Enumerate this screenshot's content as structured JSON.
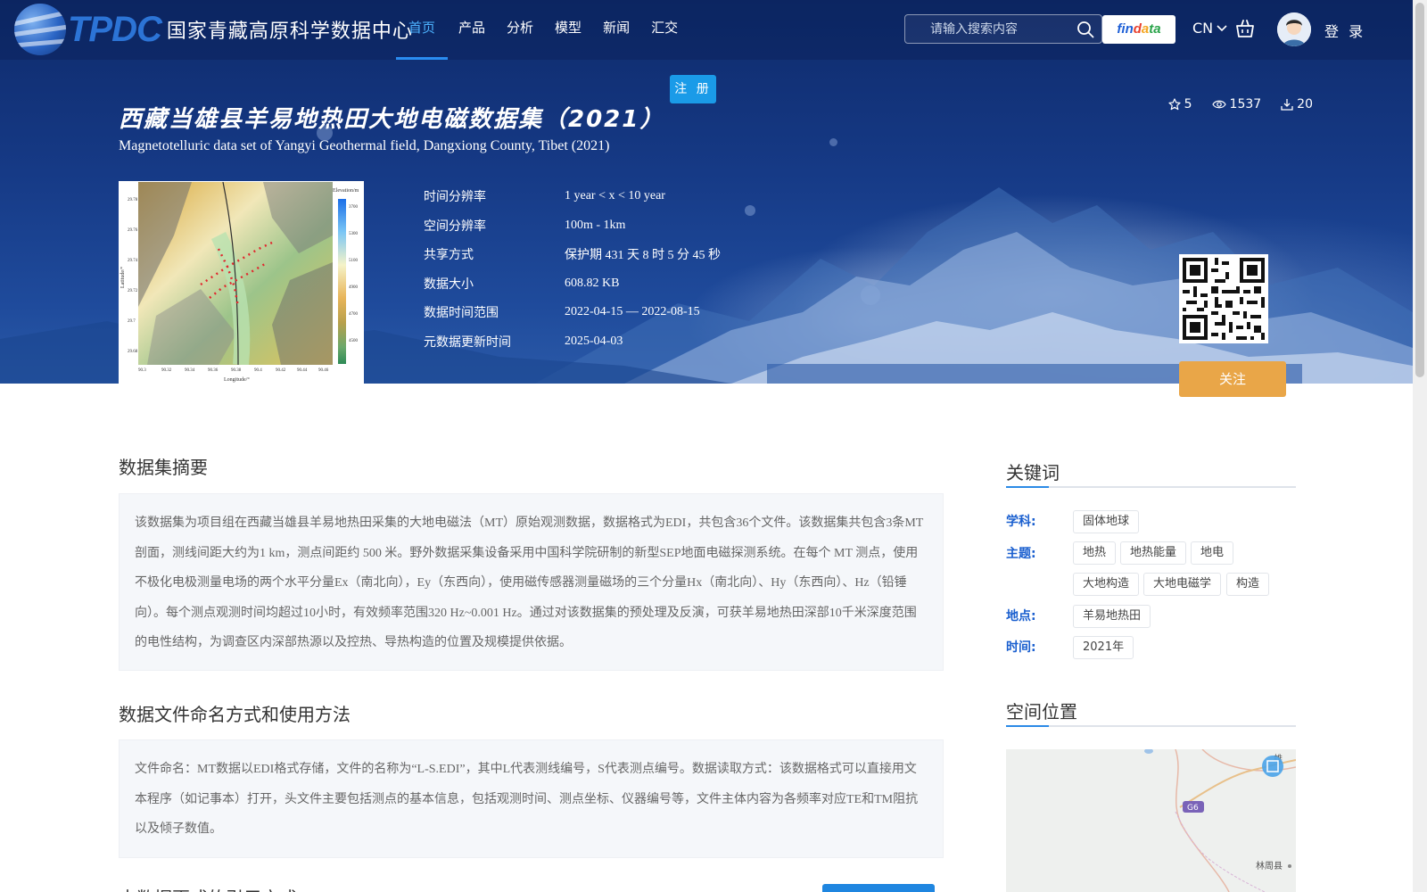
{
  "nav": {
    "logo_text": "TPDC",
    "logo_name": "国家青藏高原科学数据中心",
    "menu": [
      {
        "label": "首页",
        "active": true
      },
      {
        "label": "产品"
      },
      {
        "label": "分析"
      },
      {
        "label": "模型"
      },
      {
        "label": "新闻"
      },
      {
        "label": "汇交"
      }
    ],
    "search_placeholder": "请输入搜索内容",
    "findata": [
      "fin",
      "d",
      "a",
      "ta"
    ],
    "lang": "CN",
    "login": "登 录",
    "register": "注 册"
  },
  "dataset": {
    "title_cn": "西藏当雄县羊易地热田大地电磁数据集（2021）",
    "title_en": "Magnetotelluric data set of Yangyi Geothermal field, Dangxiong County, Tibet (2021)",
    "stats": {
      "stars": "5",
      "views": "1537",
      "downloads": "20"
    },
    "meta": [
      {
        "key": "时间分辨率",
        "value": "1 year < x < 10 year"
      },
      {
        "key": "空间分辨率",
        "value": "100m - 1km"
      },
      {
        "key": "共享方式",
        "value": "保护期 431 天 8 时 5 分 45 秒"
      },
      {
        "key": "数据大小",
        "value": "608.82 KB"
      },
      {
        "key": "数据时间范围",
        "value": "2022-04-15 — 2022-08-15"
      },
      {
        "key": "元数据更新时间",
        "value": "2025-04-03"
      }
    ],
    "thumbnail": {
      "legend_title": "Elevation/m",
      "legend_ticks": [
        "3700",
        "5300",
        "5100",
        "4900",
        "4700",
        "4500"
      ],
      "y_ticks": [
        "29.78",
        "29.76",
        "29.74",
        "29.72",
        "29.7",
        "29.68"
      ],
      "x_ticks": [
        "90.3",
        "90.32",
        "90.34",
        "90.36",
        "90.38",
        "90.4",
        "90.42",
        "90.44",
        "90.46"
      ],
      "xlabel": "Longitude/°",
      "ylabel": "Latitude/°"
    },
    "follow": "关注"
  },
  "abstract": {
    "title": "数据集摘要",
    "text": "该数据集为项目组在西藏当雄县羊易地热田采集的大地电磁法（MT）原始观测数据，数据格式为EDI，共包含36个文件。该数据集共包含3条MT剖面，测线间距大约为1 km，测点间距约 500 米。野外数据采集设备采用中国科学院研制的新型SEP地面电磁探测系统。在每个 MT 测点，使用不极化电极测量电场的两个水平分量Ex（南北向），Ey（东西向），使用磁传感器测量磁场的三个分量Hx（南北向）、Hy（东西向）、Hz（铅锤向）。每个测点观测时间均超过10小时，有效频率范围320 Hz~0.001 Hz。通过对该数据集的预处理及反演，可获羊易地热田深部10千米深度范围的电性结构，为调查区内深部热源以及控热、导热构造的位置及规模提供依据。"
  },
  "naming": {
    "title": "数据文件命名方式和使用方法",
    "text": "文件命名：MT数据以EDI格式存储，文件的名称为“L-S.EDI”，其中L代表测线编号，S代表测点编号。数据读取方式：该数据格式可以直接用文本程序（如记事本）打开，头文件主要包括测点的基本信息，包括观测时间、测点坐标、仪器编号等，文件主体内容为各频率对应TE和TM阻抗以及倾子数值。"
  },
  "next_section_partial": "本数据更式的引用方式",
  "keywords": {
    "title": "关键词",
    "subject_label": "学科:",
    "subjects": [
      "固体地球"
    ],
    "theme_label": "主题:",
    "themes": [
      "地热",
      "地热能量",
      "地电",
      "大地构造",
      "大地电磁学",
      "构造"
    ],
    "place_label": "地点:",
    "places": [
      "羊易地热田"
    ],
    "time_label": "时间:",
    "times": [
      "2021年"
    ]
  },
  "location": {
    "title": "空间位置",
    "road": "G6",
    "county1": "林周县",
    "county2": "雄"
  }
}
